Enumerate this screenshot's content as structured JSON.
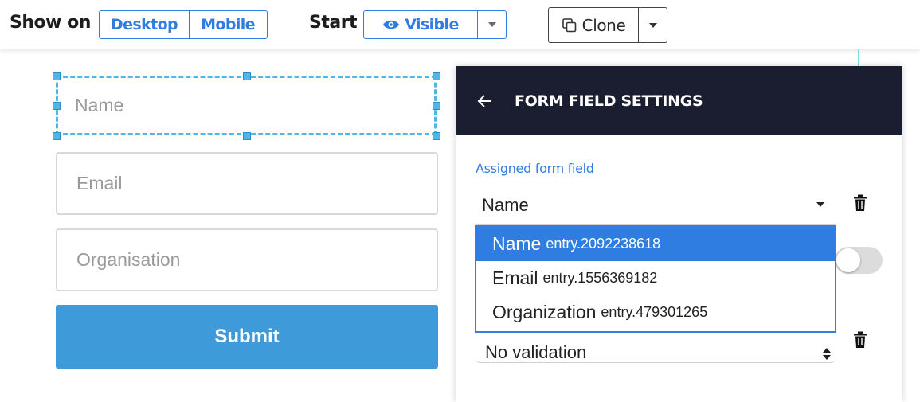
{
  "toolbar": {
    "show_on_label": "Show on",
    "show_on_options": [
      "Desktop",
      "Mobile"
    ],
    "start_label": "Start",
    "start_value": "Visible",
    "clone_label": "Clone"
  },
  "form": {
    "fields": [
      "Name",
      "Email",
      "Organisation"
    ],
    "submit_label": "Submit"
  },
  "panel": {
    "title": "FORM FIELD SETTINGS",
    "assigned_label": "Assigned form field",
    "assigned_value": "Name",
    "validation_value": "No validation",
    "dropdown_options": [
      {
        "name": "Name",
        "id": "entry.2092238618"
      },
      {
        "name": "Email",
        "id": "entry.1556369182"
      },
      {
        "name": "Organization",
        "id": "entry.479301265"
      }
    ]
  },
  "colors": {
    "accent": "#2f7de1",
    "header_bg": "#1b1e31",
    "submit_bg": "#3e9ad9",
    "selection": "#4fb7e8"
  },
  "icons": [
    "eye-icon",
    "clone-icon",
    "back-arrow-icon",
    "trash-icon"
  ]
}
